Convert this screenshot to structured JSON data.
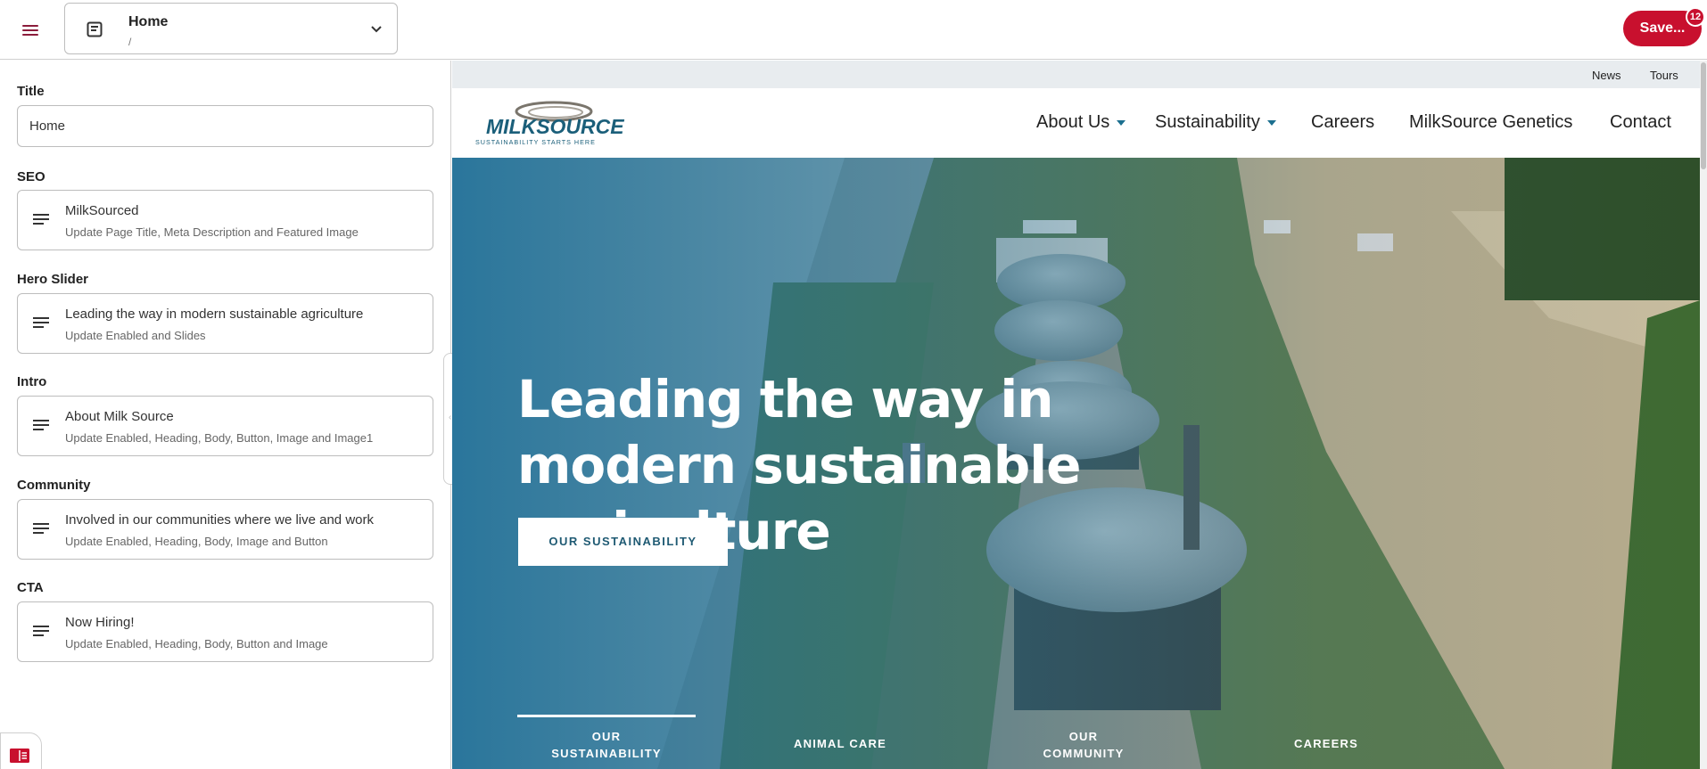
{
  "topbar": {
    "menu_icon": "hamburger-menu-icon",
    "page_select": {
      "title": "Home",
      "path": "/",
      "icon": "document-icon",
      "chevron": "chevron-down-icon"
    },
    "save": {
      "label": "Save...",
      "badge": "12"
    },
    "colors": {
      "accent": "#c8102e",
      "menu": "#8b1c3b"
    }
  },
  "sidebar": {
    "title_label": "Title",
    "title_value": "Home",
    "sections": [
      {
        "label": "SEO",
        "title": "MilkSourced",
        "subtitle": "Update Page Title, Meta Description and Featured Image"
      },
      {
        "label": "Hero Slider",
        "title": "Leading the way in modern sustainable agriculture",
        "subtitle": "Update Enabled and Slides"
      },
      {
        "label": "Intro",
        "title": "About Milk Source",
        "subtitle": "Update Enabled, Heading, Body, Button, Image and Image1"
      },
      {
        "label": "Community",
        "title": "Involved in our communities where we live and work",
        "subtitle": "Update Enabled, Heading, Body, Image and Button"
      },
      {
        "label": "CTA",
        "title": "Now Hiring!",
        "subtitle": "Update Enabled, Heading, Body, Button and Image"
      }
    ],
    "collapse_icon": "chevron-left-icon",
    "bottom_icon": "book-icon"
  },
  "preview": {
    "utility_links": [
      "News",
      "Tours"
    ],
    "logo": {
      "wordmark": "MILKSOURCE",
      "tagline": "SUSTAINABILITY STARTS HERE"
    },
    "nav": [
      {
        "label": "About Us",
        "has_caret": true
      },
      {
        "label": "Sustainability",
        "has_caret": true
      },
      {
        "label": "Careers",
        "has_caret": false
      },
      {
        "label": "MilkSource Genetics",
        "has_caret": false
      },
      {
        "label": "Contact",
        "has_caret": false
      }
    ],
    "hero": {
      "heading": "Leading the way in modern sustainable agriculture",
      "button": "OUR SUSTAINABILITY",
      "tabs": [
        "OUR SUSTAINABILITY",
        "ANIMAL CARE",
        "OUR COMMUNITY",
        "CAREERS"
      ],
      "active_tab": 0
    },
    "colors": {
      "brand_blue": "#1b6f8f",
      "utility_bg": "#e8ecef"
    }
  }
}
